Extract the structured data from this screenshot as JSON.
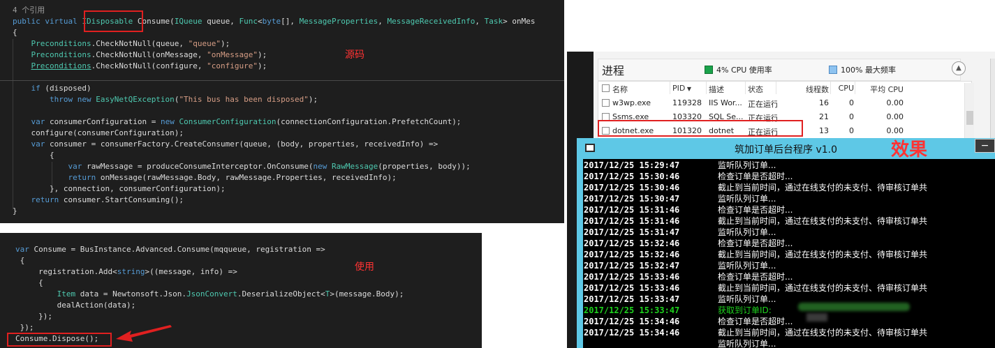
{
  "source_panel": {
    "annotation": "源码",
    "lines": [
      [
        {
          "t": "4 个引用",
          "c": "cm"
        }
      ],
      [
        {
          "t": "public virtual ",
          "c": "kw"
        },
        {
          "t": "IDisposable",
          "c": "ty"
        },
        {
          "t": " Consume(",
          "c": ""
        },
        {
          "t": "IQueue",
          "c": "ty"
        },
        {
          "t": " queue, ",
          "c": ""
        },
        {
          "t": "Func",
          "c": "ty"
        },
        {
          "t": "<",
          "c": ""
        },
        {
          "t": "byte",
          "c": "kw"
        },
        {
          "t": "[], ",
          "c": ""
        },
        {
          "t": "MessageProperties",
          "c": "ty"
        },
        {
          "t": ", ",
          "c": ""
        },
        {
          "t": "MessageReceivedInfo",
          "c": "ty"
        },
        {
          "t": ", ",
          "c": ""
        },
        {
          "t": "Task",
          "c": "ty"
        },
        {
          "t": "> onMes",
          "c": ""
        }
      ],
      [
        {
          "t": "{",
          "c": ""
        }
      ],
      [
        {
          "t": "    ",
          "c": ""
        },
        {
          "t": "Preconditions",
          "c": "ty"
        },
        {
          "t": ".CheckNotNull(queue, ",
          "c": ""
        },
        {
          "t": "\"queue\"",
          "c": "st"
        },
        {
          "t": ");",
          "c": ""
        }
      ],
      [
        {
          "t": "    ",
          "c": ""
        },
        {
          "t": "Preconditions",
          "c": "ty"
        },
        {
          "t": ".CheckNotNull(onMessage, ",
          "c": ""
        },
        {
          "t": "\"onMessage\"",
          "c": "st"
        },
        {
          "t": ");",
          "c": ""
        }
      ],
      [
        {
          "t": "    ",
          "c": ""
        },
        {
          "t": "Preconditions",
          "c": "ty ul"
        },
        {
          "t": ".CheckNotNull(configure, ",
          "c": ""
        },
        {
          "t": "\"configure\"",
          "c": "st"
        },
        {
          "t": ");",
          "c": ""
        }
      ],
      [
        {
          "t": "",
          "c": ""
        }
      ],
      [
        {
          "t": "    ",
          "c": ""
        },
        {
          "t": "if",
          "c": "kw"
        },
        {
          "t": " (disposed)",
          "c": ""
        }
      ],
      [
        {
          "t": "        ",
          "c": ""
        },
        {
          "t": "throw new ",
          "c": "kw"
        },
        {
          "t": "EasyNetQException",
          "c": "ty"
        },
        {
          "t": "(",
          "c": ""
        },
        {
          "t": "\"This bus has been disposed\"",
          "c": "st"
        },
        {
          "t": ");",
          "c": ""
        }
      ],
      [
        {
          "t": "",
          "c": ""
        }
      ],
      [
        {
          "t": "    ",
          "c": ""
        },
        {
          "t": "var",
          "c": "kw"
        },
        {
          "t": " consumerConfiguration = ",
          "c": ""
        },
        {
          "t": "new ",
          "c": "kw"
        },
        {
          "t": "ConsumerConfiguration",
          "c": "ty"
        },
        {
          "t": "(connectionConfiguration.PrefetchCount);",
          "c": ""
        }
      ],
      [
        {
          "t": "    configure(consumerConfiguration);",
          "c": ""
        }
      ],
      [
        {
          "t": "    ",
          "c": ""
        },
        {
          "t": "var",
          "c": "kw"
        },
        {
          "t": " consumer = consumerFactory.CreateConsumer(queue, (body, properties, receivedInfo) =>",
          "c": ""
        }
      ],
      [
        {
          "t": "        {",
          "c": ""
        }
      ],
      [
        {
          "t": "            ",
          "c": ""
        },
        {
          "t": "var",
          "c": "kw"
        },
        {
          "t": " rawMessage = produceConsumeInterceptor.OnConsume(",
          "c": ""
        },
        {
          "t": "new ",
          "c": "kw"
        },
        {
          "t": "RawMessage",
          "c": "ty"
        },
        {
          "t": "(properties, body));",
          "c": ""
        }
      ],
      [
        {
          "t": "            ",
          "c": ""
        },
        {
          "t": "return",
          "c": "kw"
        },
        {
          "t": " onMessage(rawMessage.Body, rawMessage.Properties, receivedInfo);",
          "c": ""
        }
      ],
      [
        {
          "t": "        }, connection, consumerConfiguration);",
          "c": ""
        }
      ],
      [
        {
          "t": "    ",
          "c": ""
        },
        {
          "t": "return",
          "c": "kw"
        },
        {
          "t": " consumer.StartConsuming();",
          "c": ""
        }
      ],
      [
        {
          "t": "}",
          "c": ""
        }
      ]
    ]
  },
  "usage_panel": {
    "annotation": "使用",
    "lines": [
      [
        {
          "t": "var",
          "c": "kw"
        },
        {
          "t": " Consume = BusInstance.Advanced.Consume(mqqueue, registration =>",
          "c": ""
        }
      ],
      [
        {
          "t": " {",
          "c": ""
        }
      ],
      [
        {
          "t": "     registration.Add<",
          "c": ""
        },
        {
          "t": "string",
          "c": "kw"
        },
        {
          "t": ">((message, info) =>",
          "c": ""
        }
      ],
      [
        {
          "t": "     {",
          "c": ""
        }
      ],
      [
        {
          "t": "         ",
          "c": ""
        },
        {
          "t": "Item",
          "c": "ty"
        },
        {
          "t": " data = Newtonsoft.Json.",
          "c": ""
        },
        {
          "t": "JsonConvert",
          "c": "ty"
        },
        {
          "t": ".DeserializeObject<",
          "c": ""
        },
        {
          "t": "T",
          "c": "ty"
        },
        {
          "t": ">(message.Body);",
          "c": ""
        }
      ],
      [
        {
          "t": "         dealAction(data);",
          "c": ""
        }
      ],
      [
        {
          "t": "     });",
          "c": ""
        }
      ],
      [
        {
          "t": " });",
          "c": ""
        }
      ],
      [
        {
          "t": "Consume.Dispose();",
          "c": ""
        }
      ]
    ]
  },
  "task_manager": {
    "title": "进程",
    "cpu_usage": "4% CPU 使用率",
    "max_freq": "100% 最大频率",
    "collapse_icon": "chevron-up-icon",
    "columns": [
      "名称",
      "PID",
      "描述",
      "状态",
      "线程数",
      "CPU",
      "平均 CPU"
    ],
    "rows": [
      {
        "name": "w3wp.exe",
        "pid": "119328",
        "desc": "IIS Wor...",
        "status": "正在运行",
        "threads": "16",
        "cpu": "0",
        "avg_cpu": "0.00"
      },
      {
        "name": "Ssms.exe",
        "pid": "103320",
        "desc": "SQL Se...",
        "status": "正在运行",
        "threads": "21",
        "cpu": "0",
        "avg_cpu": "0.00"
      },
      {
        "name": "dotnet.exe",
        "pid": "101320",
        "desc": "dotnet",
        "status": "正在运行",
        "threads": "13",
        "cpu": "0",
        "avg_cpu": "0.00"
      }
    ]
  },
  "console": {
    "title": "筑加订单后台程序 v1.0",
    "minimize_label": "−",
    "annotation": "效果",
    "lines": [
      {
        "time": "2017/12/25 15:29:47",
        "msg": "监听队列订单...",
        "highlight": false
      },
      {
        "time": "2017/12/25 15:30:46",
        "msg": "检查订单是否超时...",
        "highlight": false
      },
      {
        "time": "2017/12/25 15:30:46",
        "msg": "截止到当前时间，通过在线支付的未支付、待审核订单共",
        "highlight": false
      },
      {
        "time": "2017/12/25 15:30:47",
        "msg": "监听队列订单...",
        "highlight": false
      },
      {
        "time": "2017/12/25 15:31:46",
        "msg": "检查订单是否超时...",
        "highlight": false
      },
      {
        "time": "2017/12/25 15:31:46",
        "msg": "截止到当前时间，通过在线支付的未支付、待审核订单共",
        "highlight": false
      },
      {
        "time": "2017/12/25 15:31:47",
        "msg": "监听队列订单...",
        "highlight": false
      },
      {
        "time": "2017/12/25 15:32:46",
        "msg": "检查订单是否超时...",
        "highlight": false
      },
      {
        "time": "2017/12/25 15:32:46",
        "msg": "截止到当前时间，通过在线支付的未支付、待审核订单共",
        "highlight": false
      },
      {
        "time": "2017/12/25 15:32:47",
        "msg": "监听队列订单...",
        "highlight": false
      },
      {
        "time": "2017/12/25 15:33:46",
        "msg": "检查订单是否超时...",
        "highlight": false
      },
      {
        "time": "2017/12/25 15:33:46",
        "msg": "截止到当前时间，通过在线支付的未支付、待审核订单共",
        "highlight": false
      },
      {
        "time": "2017/12/25 15:33:47",
        "msg": "监听队列订单...",
        "highlight": false
      },
      {
        "time": "2017/12/25 15:33:47",
        "msg": "获取到订单ID:",
        "highlight": true
      },
      {
        "time": "2017/12/25 15:34:46",
        "msg": "检查订单是否超时...",
        "highlight": false
      },
      {
        "time": "2017/12/25 15:34:46",
        "msg": "截止到当前时间，通过在线支付的未支付、待审核订单共",
        "highlight": false
      },
      {
        "time": "",
        "msg": "监听队列订单...",
        "highlight": false
      }
    ]
  },
  "colors": {
    "code_bg": "#1e1e1e",
    "keyword": "#569cd6",
    "type": "#4ec9b0",
    "string": "#d69d85",
    "annotation_red": "#e02020",
    "console_frame": "#5ec8e6",
    "console_highlight": "#1ed21e"
  }
}
